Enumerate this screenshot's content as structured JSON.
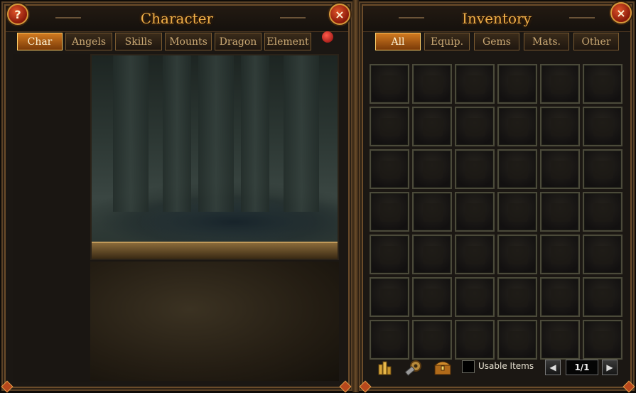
{
  "character": {
    "title": "Character",
    "help_label": "?",
    "close_label": "×",
    "tabs": [
      "Char",
      "Angels",
      "Skills",
      "Mounts",
      "Dragon",
      "Element"
    ],
    "active_tab": "Char"
  },
  "inventory": {
    "title": "Inventory",
    "close_label": "×",
    "tabs": [
      "All",
      "Equip.",
      "Gems",
      "Mats.",
      "Other"
    ],
    "active_tab": "All",
    "grid_rows": 7,
    "grid_cols": 6,
    "usable_items_label": "Usable Items",
    "page_indicator": "1/1",
    "prev_label": "◀",
    "next_label": "▶"
  },
  "colors": {
    "title_gold": "#f0b04a",
    "tab_active": "#d27a20",
    "close_red": "#e0552a"
  }
}
